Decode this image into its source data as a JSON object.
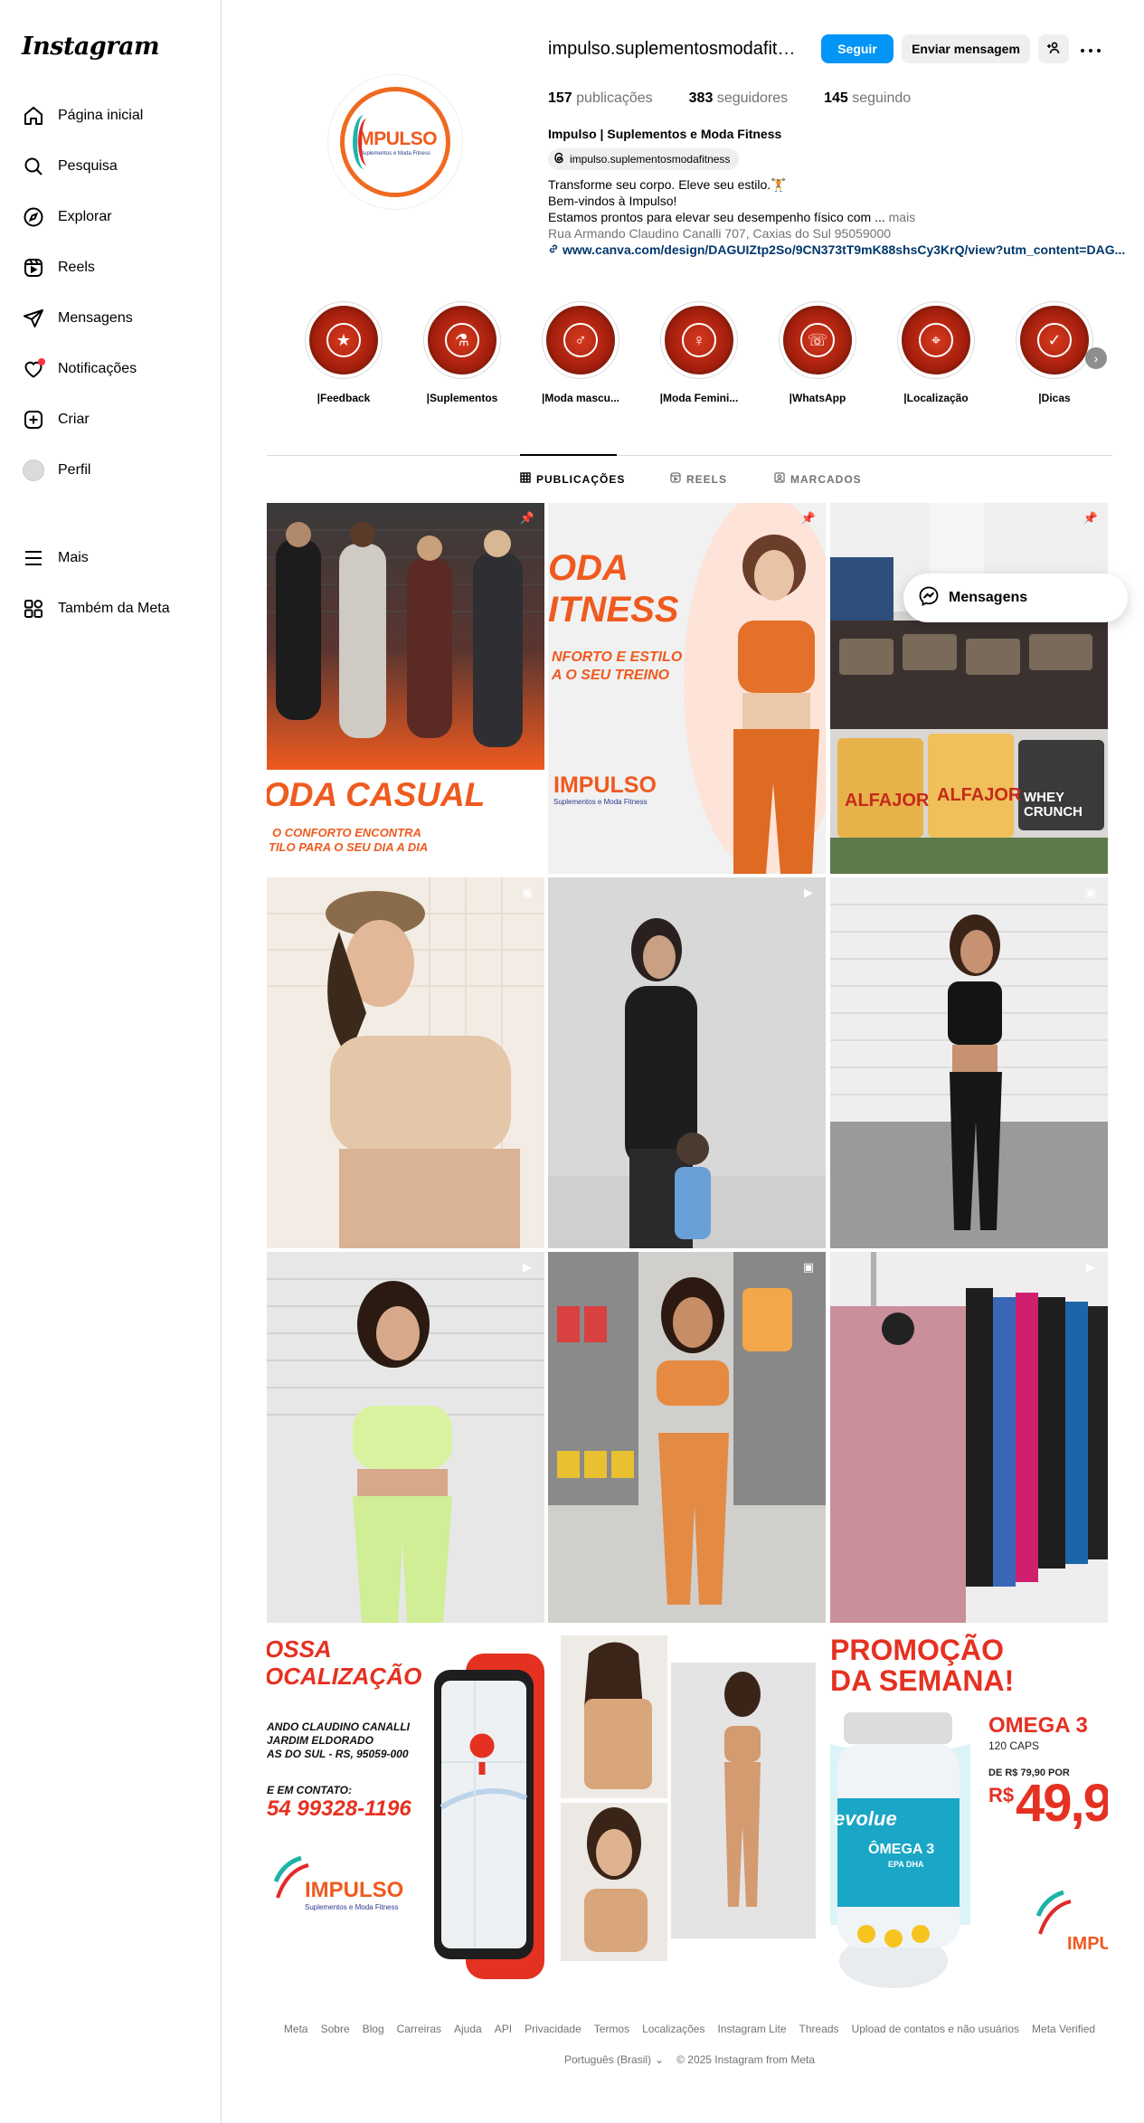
{
  "sidebar": {
    "logo": "Instagram",
    "items": [
      {
        "label": "Página inicial",
        "icon": "home-icon"
      },
      {
        "label": "Pesquisa",
        "icon": "search-icon"
      },
      {
        "label": "Explorar",
        "icon": "compass-icon"
      },
      {
        "label": "Reels",
        "icon": "reels-icon"
      },
      {
        "label": "Mensagens",
        "icon": "send-icon"
      },
      {
        "label": "Notificações",
        "icon": "heart-icon"
      },
      {
        "label": "Criar",
        "icon": "plus-square-icon"
      },
      {
        "label": "Perfil",
        "icon": "avatar"
      },
      {
        "label": "Mais",
        "icon": "menu-icon"
      },
      {
        "label": "Também da Meta",
        "icon": "meta-grid-icon"
      }
    ]
  },
  "profile": {
    "avatar_word": "IMPULSO",
    "avatar_sub": "Suplementos e Moda Fitness",
    "username": "impulso.suplementosmodafitness",
    "follow_label": "Seguir",
    "message_label": "Enviar mensagem",
    "stats": {
      "posts_count": "157",
      "posts_label": "publicações",
      "followers_count": "383",
      "followers_label": "seguidores",
      "following_count": "145",
      "following_label": "seguindo"
    },
    "full_name": "Impulso | Suplementos e Moda Fitness",
    "threads_handle": "impulso.suplementosmodafitness",
    "bio_line1": "Transforme seu corpo. Eleve seu estilo.🏋️",
    "bio_line2": "Bem-vindos à Impulso!",
    "bio_line3": "Estamos prontos para elevar seu desempenho físico com ...",
    "bio_more": "mais",
    "address": "Rua Armando Claudino Canalli 707, Caxias do Sul 95059000",
    "link": "www.canva.com/design/DAGUIZtp2So/9CN373tT9mK88shsCy3KrQ/view?utm_content=DAG..."
  },
  "highlights": [
    {
      "label": "|Feedback",
      "glyph": "★"
    },
    {
      "label": "|Suplementos",
      "glyph": "⚗"
    },
    {
      "label": "|Moda mascu...",
      "glyph": "♂"
    },
    {
      "label": "|Moda Femini...",
      "glyph": "♀"
    },
    {
      "label": "|WhatsApp",
      "glyph": "☏"
    },
    {
      "label": "|Localização",
      "glyph": "⌖"
    },
    {
      "label": "|Dicas",
      "glyph": "✓"
    }
  ],
  "tabs": [
    {
      "label": "PUBLICAÇÕES",
      "icon": "grid-icon"
    },
    {
      "label": "REELS",
      "icon": "reels-icon"
    },
    {
      "label": "MARCADOS",
      "icon": "tagged-icon"
    }
  ],
  "floating_messages": "Mensagens",
  "posts": {
    "p1": {
      "title": "ODA CASUAL",
      "line1": "O CONFORTO ENCONTRA",
      "line2": "TILO PARA O SEU DIA A DIA"
    },
    "p2": {
      "title1": "ODA",
      "title2": "ITNESS",
      "sub1": "NFORTO E ESTILO",
      "sub2": "A O SEU TREINO",
      "brand": "IMPULSO",
      "brand_sub": "Suplementos e Moda Fitness"
    },
    "p3": {
      "label1": "ALFAJOR",
      "label2": "ALFAJOR",
      "label3": "WHEY CRUNCH"
    },
    "p10": {
      "title1": "OSSA",
      "title2": "OCALIZAÇÃO",
      "addr1": "ANDO CLAUDINO CANALLI",
      "addr2": "JARDIM ELDORADO",
      "addr3": "AS DO SUL - RS, 95059-000",
      "contact_label": "E EM CONTATO:",
      "phone": "54 99328-1196",
      "brand": "IMPULSO",
      "brand_sub": "Suplementos e Moda Fitness"
    },
    "p12": {
      "title1": "PROMOÇÃO",
      "title2": "DA SEMANA!",
      "product": "OMEGA 3",
      "caps": "120 CAPS",
      "from": "DE R$ 79,90 POR",
      "currency": "R$",
      "price": "49,9",
      "brand": "IMPUL",
      "bottle_brand": "evolue",
      "bottle_name": "ÔMEGA 3",
      "bottle_sub": "EPA DHA"
    }
  },
  "footer": {
    "links": [
      "Meta",
      "Sobre",
      "Blog",
      "Carreiras",
      "Ajuda",
      "API",
      "Privacidade",
      "Termos",
      "Localizações",
      "Instagram Lite",
      "Threads",
      "Upload de contatos e não usuários",
      "Meta Verified"
    ],
    "language": "Português (Brasil)",
    "copyright": "© 2025 Instagram from Meta"
  },
  "colors": {
    "accent": "#0095f6",
    "brand_orange": "#ef5a1f",
    "brand_red": "#e53121"
  }
}
